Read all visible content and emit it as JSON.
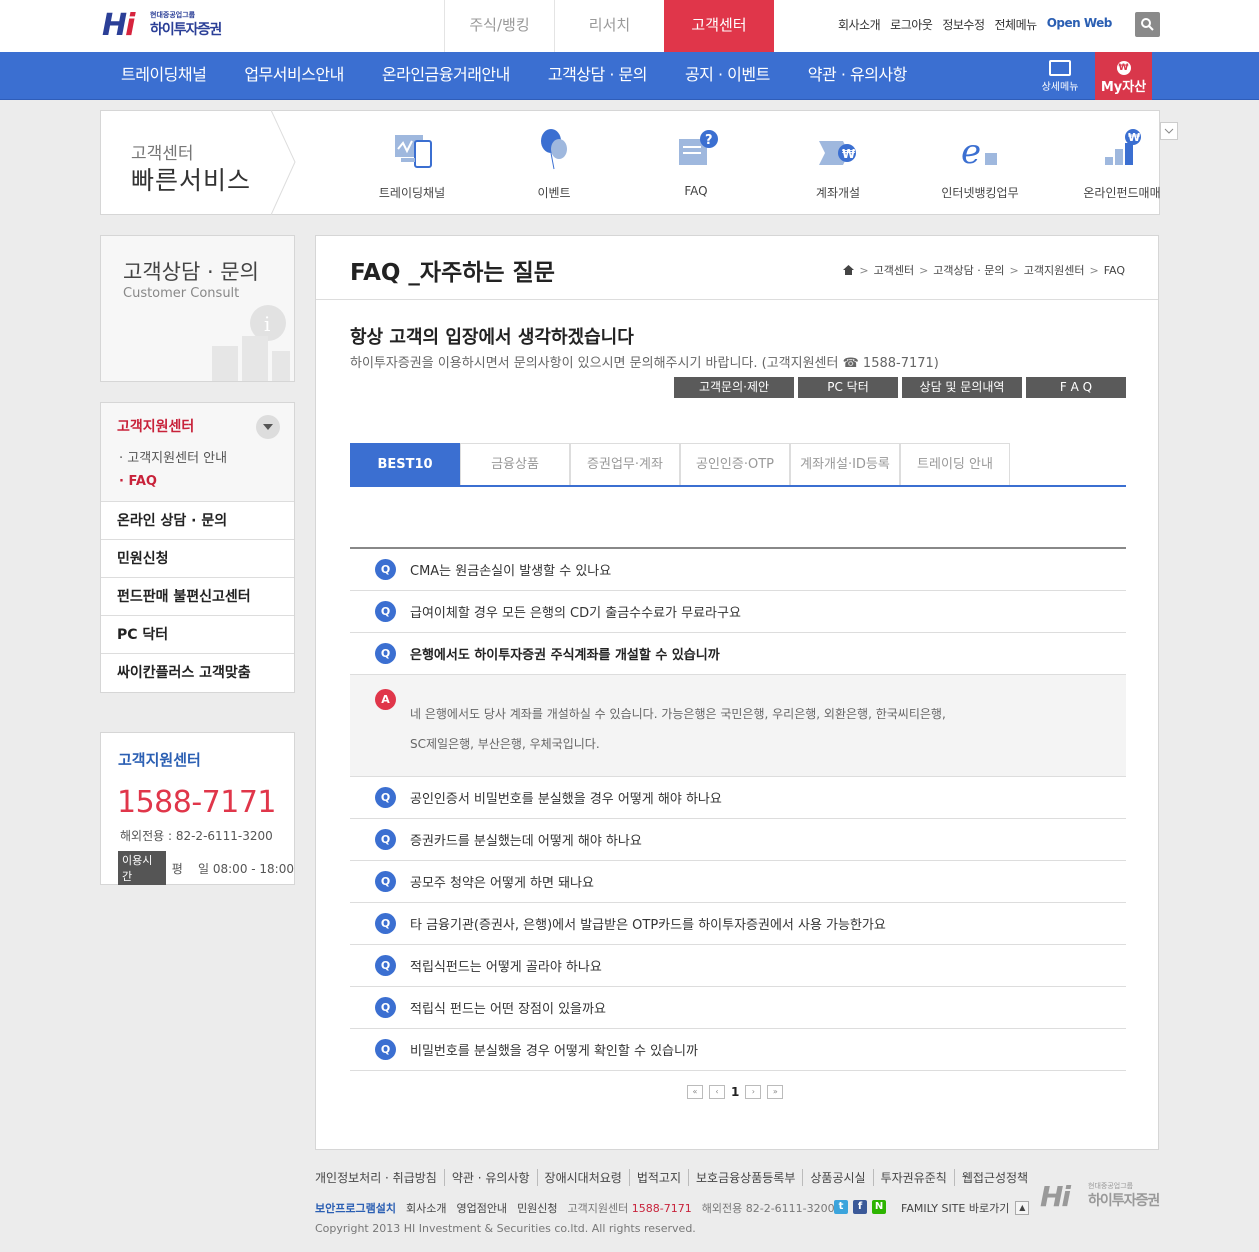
{
  "header": {
    "logo_group": "현대중공업그룹",
    "logo_name": "하이투자증권",
    "logo_mark": "Hi",
    "top_tabs": [
      "주식/뱅킹",
      "리서치",
      "고객센터"
    ],
    "util_links": [
      "회사소개",
      "로그아웃",
      "정보수정",
      "전체메뉴",
      "Open Web"
    ]
  },
  "gnb": {
    "items": [
      "트레이딩채널",
      "업무서비스안내",
      "온라인금융거래안내",
      "고객상담 · 문의",
      "공지 · 이벤트",
      "약관 · 유의사항"
    ],
    "detail_menu": "상세메뉴",
    "my_asset": "My자산",
    "won_symbol": "₩"
  },
  "quick": {
    "subtitle": "고객센터",
    "title": "빠른서비스",
    "items": [
      {
        "label": "트레이딩채널",
        "icon": "monitor-phone-icon"
      },
      {
        "label": "이벤트",
        "icon": "balloon-icon"
      },
      {
        "label": "FAQ",
        "icon": "faq-document-icon"
      },
      {
        "label": "계좌개설",
        "icon": "account-open-icon"
      },
      {
        "label": "인터넷뱅킹업무",
        "icon": "internet-explorer-icon"
      },
      {
        "label": "온라인펀드매매",
        "icon": "fund-chart-icon"
      }
    ]
  },
  "lnb": {
    "title": "고객상담 · 문의",
    "subtitle": "Customer Consult",
    "group_title": "고객지원센터",
    "group_items": [
      "· 고객지원센터 안내",
      "· FAQ"
    ],
    "items": [
      "온라인 상담 · 문의",
      "민원신청",
      "펀드판매 불편신고센터",
      "PC 닥터",
      "싸이칸플러스 고객맞춤"
    ]
  },
  "cs_box": {
    "title": "고객지원센터",
    "phone": "1588-7171",
    "overseas": "해외전용 : 82-2-6111-3200",
    "hours_tag": "이용시간",
    "hours": "평    일 08:00 - 18:00"
  },
  "main": {
    "title": "FAQ _자주하는 질문",
    "breadcrumb": [
      "고객센터",
      "고객상담 · 문의",
      "고객지원센터",
      "FAQ"
    ],
    "greet": "항상 고객의 입장에서 생각하겠습니다",
    "desc": "하이투자증권을 이용하시면서 문의사항이 있으시면 문의해주시기 바랍니다. (고객지원센터 ☎ 1588-7171)",
    "buttons": [
      "고객문의·제안",
      "PC 닥터",
      "상담 및 문의내역",
      "F A Q"
    ],
    "tabs": [
      "BEST10",
      "금융상품",
      "증권업무·계좌",
      "공인인증·OTP",
      "계좌개설·ID등록",
      "트레이딩 안내"
    ],
    "q_label": "Q",
    "a_label": "A",
    "questions": [
      "CMA는 원금손실이 발생할 수 있나요",
      "급여이체할 경우 모든 은행의 CD기 출금수수료가 무료라구요",
      "은행에서도 하이투자증권 주식계좌를 개설할 수 있습니까",
      "공인인증서 비밀번호를 분실했을 경우 어떻게 해야 하나요",
      "증권카드를 분실했는데 어떻게 해야 하나요",
      "공모주 청약은 어떻게 하면 돼나요",
      "타 금융기관(증권사, 은행)에서 발급받은 OTP카드를 하이투자증권에서 사용 가능한가요",
      "적립식펀드는 어떻게 골라야 하나요",
      "적립식 펀드는 어떤 장점이 있을까요",
      "비밀번호를 분실했을 경우 어떻게 확인할 수 있습니까"
    ],
    "answer_line1": "네 은행에서도 당사 계좌를 개설하실 수 있습니다. 가능은행은 국민은행, 우리은행, 외환은행, 한국씨티은행,",
    "answer_line2": "SC제일은행, 부산은행, 우체국입니다.",
    "pager": {
      "first": "«",
      "prev": "‹",
      "page": "1",
      "next": "›",
      "last": "»"
    }
  },
  "footer": {
    "links": [
      "개인정보처리 · 취급방침",
      "약관 · 유의사항",
      "장애시대처요령",
      "법적고지",
      "보호금융상품등록부",
      "상품공시실",
      "투자권유준칙",
      "웹접근성정책"
    ],
    "row2": [
      "보안프로그램설치",
      "회사소개",
      "영업점안내",
      "민원신청"
    ],
    "cs_label": "고객지원센터",
    "cs_phone": "1588-7171",
    "overseas": "해외전용 82-2-6111-3200",
    "family": "FAMILY SITE 바로가기",
    "copyright": "Copyright 2013 HI Investment & Securities co.ltd. All rights reserved."
  }
}
